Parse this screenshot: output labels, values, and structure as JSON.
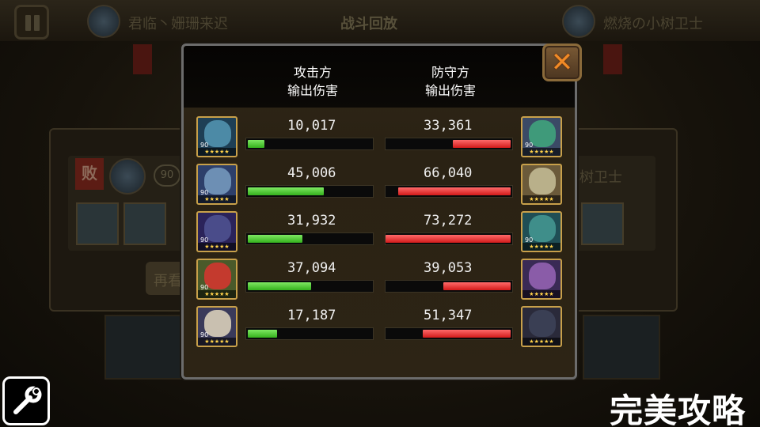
{
  "background": {
    "title": "战斗回放",
    "attacker_name": "君临丶姗珊来迟",
    "defender_name": "燃烧の小树卫士",
    "defeat_badge": "败",
    "level_badge": "90",
    "replay_button_partial": "再看",
    "defender_name_partial": "小树卫士"
  },
  "dialog": {
    "attacker_header_line1": "攻击方",
    "attacker_header_line2": "输出伤害",
    "defender_header_line1": "防守方",
    "defender_header_line2": "输出伤害",
    "close_icon": "x-close-icon"
  },
  "rows": [
    {
      "attacker_value": "10,017",
      "defender_value": "33,361",
      "attacker_level": "90",
      "defender_level": "90",
      "attacker_stars": "★★★★★",
      "defender_stars": "★★★★★",
      "attacker_fill": 0.135,
      "defender_fill": 0.46
    },
    {
      "attacker_value": "45,006",
      "defender_value": "66,040",
      "attacker_level": "90",
      "defender_level": "",
      "attacker_stars": "★★★★★",
      "defender_stars": "★★★★★",
      "attacker_fill": 0.61,
      "defender_fill": 0.9
    },
    {
      "attacker_value": "31,932",
      "defender_value": "73,272",
      "attacker_level": "90",
      "defender_level": "90",
      "attacker_stars": "★★★★★",
      "defender_stars": "★★★★★",
      "attacker_fill": 0.435,
      "defender_fill": 1.0
    },
    {
      "attacker_value": "37,094",
      "defender_value": "39,053",
      "attacker_level": "90",
      "defender_level": "",
      "attacker_stars": "★★★★★",
      "defender_stars": "★★★★★",
      "attacker_fill": 0.505,
      "defender_fill": 0.535
    },
    {
      "attacker_value": "17,187",
      "defender_value": "51,347",
      "attacker_level": "90",
      "defender_level": "",
      "attacker_stars": "★★★★★",
      "defender_stars": "★★★★★",
      "attacker_fill": 0.235,
      "defender_fill": 0.7
    }
  ],
  "overlay": {
    "watermark": "完美攻略",
    "tool_icon": "wrench-icon"
  }
}
